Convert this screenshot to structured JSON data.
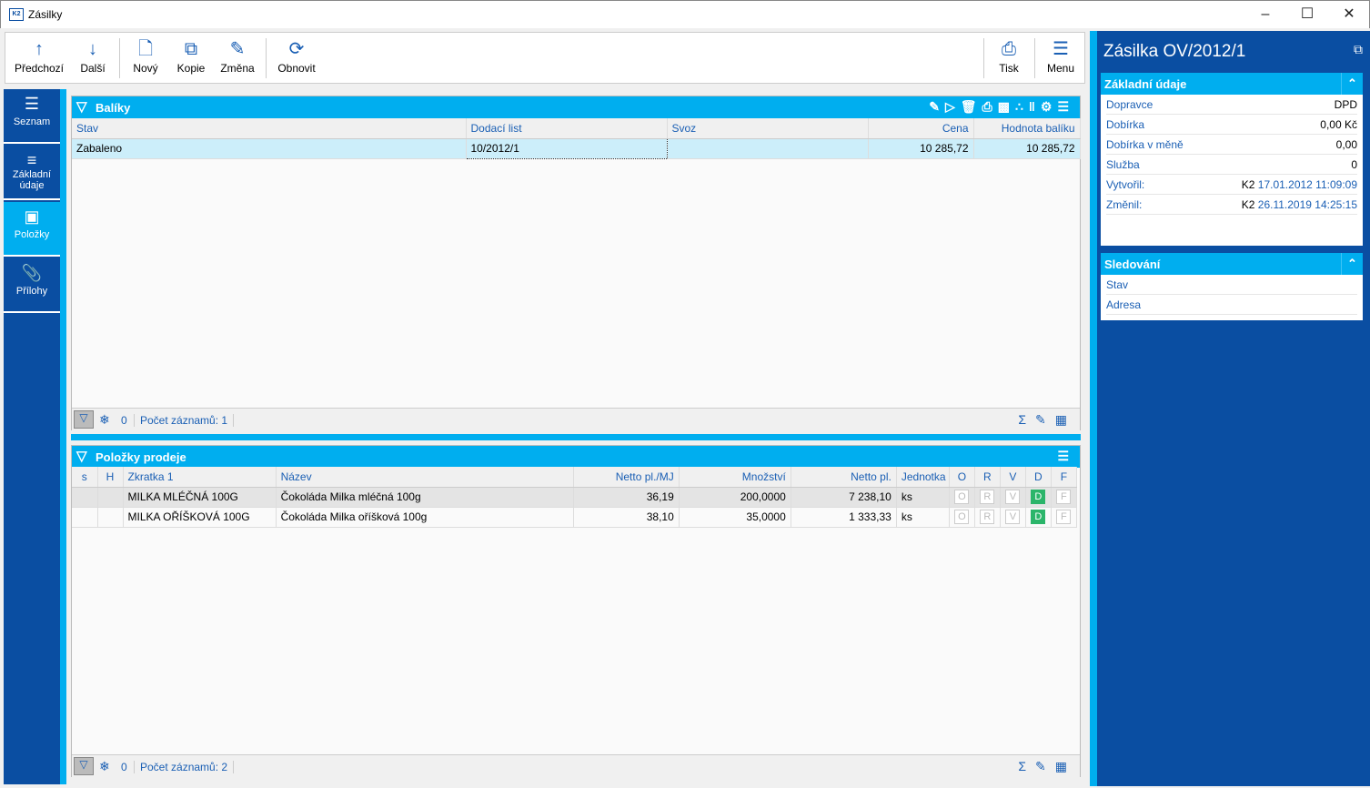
{
  "window": {
    "title": "Zásilky",
    "app_icon": "K2",
    "controls": [
      "minimize",
      "maximize",
      "close"
    ]
  },
  "toolbar": {
    "buttons": [
      {
        "label": "Předchozí",
        "icon": "arrow-up"
      },
      {
        "label": "Další",
        "icon": "arrow-down"
      },
      {
        "label": "Nový",
        "icon": "new-doc"
      },
      {
        "label": "Kopie",
        "icon": "copy"
      },
      {
        "label": "Změna",
        "icon": "pencil"
      },
      {
        "label": "Obnovit",
        "icon": "refresh"
      },
      {
        "label": "Tisk",
        "icon": "printer"
      },
      {
        "label": "Menu",
        "icon": "hamburger"
      }
    ]
  },
  "sidebar": {
    "items": [
      {
        "label": "Seznam"
      },
      {
        "label": "Základní údaje"
      },
      {
        "label": "Položky",
        "active": true
      },
      {
        "label": "Přílohy"
      }
    ]
  },
  "baliky": {
    "title": "Balíky",
    "columns": [
      "Stav",
      "Dodací list",
      "Svoz",
      "Cena",
      "Hodnota balíku"
    ],
    "rows": [
      [
        "Zabaleno",
        "10/2012/1",
        "",
        "10 285,72",
        "10 285,72"
      ]
    ],
    "footer": {
      "filter_count": "0",
      "records": "Počet záznamů: 1"
    }
  },
  "polozky": {
    "title": "Položky prodeje",
    "columns": [
      "s",
      "H",
      "Zkratka 1",
      "Název",
      "Netto pl./MJ",
      "Množství",
      "Netto pl.",
      "Jednotka",
      "O",
      "R",
      "V",
      "D",
      "F"
    ],
    "rows": [
      [
        "",
        "",
        "MILKA MLÉČNÁ 100G",
        "Čokoláda Milka mléčná 100g",
        "36,19",
        "200,0000",
        "7 238,10",
        "ks"
      ],
      [
        "",
        "",
        "MILKA OŘÍŠKOVÁ 100G",
        "Čokoláda Milka oříšková 100g",
        "38,10",
        "35,0000",
        "1 333,33",
        "ks"
      ]
    ],
    "flags": [
      "O",
      "R",
      "V",
      "D",
      "F"
    ],
    "footer": {
      "filter_count": "0",
      "records": "Počet záznamů: 2"
    }
  },
  "detail": {
    "title": "Zásilka OV/2012/1",
    "zakladni": {
      "title": "Základní údaje",
      "rows": [
        {
          "k": "Dopravce",
          "v": "DPD"
        },
        {
          "k": "Dobírka",
          "v": "0,00 Kč"
        },
        {
          "k": "Dobírka v měně",
          "v": "0,00"
        },
        {
          "k": "Služba",
          "v": "0"
        }
      ],
      "created": {
        "k": "Vytvořil:",
        "user": "K2",
        "dt": "17.01.2012 11:09:09"
      },
      "changed": {
        "k": "Změnil:",
        "user": "K2",
        "dt": "26.11.2019 14:25:15"
      }
    },
    "sledovani": {
      "title": "Sledování",
      "rows": [
        "Stav",
        "Adresa"
      ]
    }
  },
  "colors": {
    "accent": "#00aeef",
    "dark": "#0a4ea2",
    "flag_on": "#2bb56a"
  }
}
